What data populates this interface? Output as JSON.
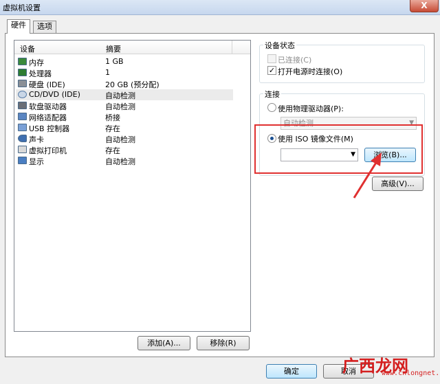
{
  "window": {
    "title": "虚拟机设置",
    "close_label": "X"
  },
  "tabs": [
    {
      "label": "硬件",
      "active": true
    },
    {
      "label": "选项",
      "active": false
    }
  ],
  "device_list": {
    "columns": [
      "设备",
      "摘要"
    ],
    "rows": [
      {
        "name": "内存",
        "summary": "1 GB",
        "icon": "memory-icon"
      },
      {
        "name": "处理器",
        "summary": "1",
        "icon": "processor-icon"
      },
      {
        "name": "硬盘 (IDE)",
        "summary": "20 GB (预分配)",
        "icon": "hard-disk-icon"
      },
      {
        "name": "CD/DVD (IDE)",
        "summary": "自动检测",
        "icon": "cd-dvd-icon",
        "selected": true
      },
      {
        "name": "软盘驱动器",
        "summary": "自动检测",
        "icon": "floppy-icon"
      },
      {
        "name": "网络适配器",
        "summary": "桥接",
        "icon": "network-adapter-icon"
      },
      {
        "name": "USB 控制器",
        "summary": "存在",
        "icon": "usb-icon"
      },
      {
        "name": "声卡",
        "summary": "自动检测",
        "icon": "sound-card-icon"
      },
      {
        "name": "虚拟打印机",
        "summary": "存在",
        "icon": "printer-icon"
      },
      {
        "name": "显示",
        "summary": "自动检测",
        "icon": "display-icon"
      }
    ]
  },
  "list_buttons": {
    "add": "添加(A)...",
    "remove": "移除(R)"
  },
  "device_status": {
    "legend": "设备状态",
    "connected": {
      "label": "已连接(C)",
      "checked": false,
      "disabled": true
    },
    "connect_on_power": {
      "label": "打开电源时连接(O)",
      "checked": true
    }
  },
  "connection": {
    "legend": "连接",
    "physical_drive": {
      "label": "使用物理驱动器(P):",
      "checked": false
    },
    "physical_select_value": "自动检测",
    "iso_file": {
      "label": "使用 ISO 镜像文件(M)",
      "checked": true
    },
    "iso_value": "",
    "browse_label": "浏览(B)...",
    "advanced_label": "高级(V)..."
  },
  "footer": {
    "ok": "确定",
    "cancel": "取消"
  },
  "watermark": {
    "text": "广西龙网",
    "sub": "www.cnlongnet.com"
  },
  "colors": {
    "accent_red": "#e03030",
    "selection": "#ebebeb"
  }
}
